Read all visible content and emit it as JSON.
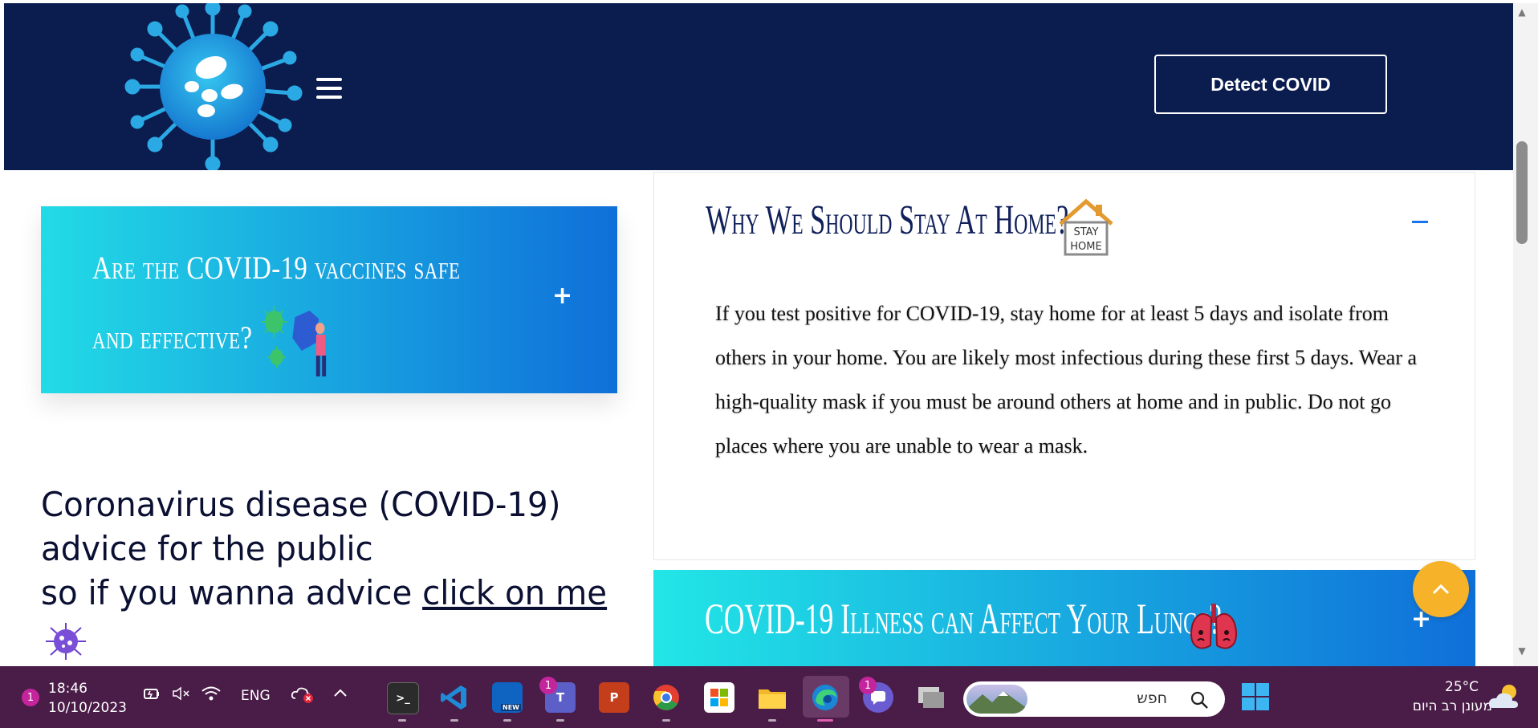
{
  "header": {
    "detect_button": "Detect COVID"
  },
  "faq": {
    "vaccines_title": "Are the COVID-19 vaccines safe and effective?",
    "vaccines_toggle": "+",
    "stay_home_title": "Why We Should Stay At Home?",
    "stay_home_icon_text_1": "STAY",
    "stay_home_icon_text_2": "HOME",
    "stay_home_toggle": "−",
    "stay_home_body": "If you test positive for COVID-19, stay home for at least 5 days and isolate from others in your home. You are likely most infectious during these first 5 days. Wear a high-quality mask if you must be around others at home and in public. Do not go places where you are unable to wear a mask.",
    "lungs_title": "COVID-19 Illness can Affect Your Lungs?",
    "lungs_toggle": "+"
  },
  "advice": {
    "line1": "Coronavirus disease (COVID-19)",
    "line2": "advice for the public",
    "line3_prefix": "so if you wanna advice ",
    "link": "click on me"
  },
  "taskbar": {
    "notification_count": "1",
    "time": "18:46",
    "date": "10/10/2023",
    "language": "ENG",
    "teams_badge": "1",
    "chat_badge": "1",
    "outlook_label": "NEW",
    "search_placeholder": "חפש",
    "weather_temp": "25°C",
    "weather_desc": "מעונן רב היום"
  },
  "colors": {
    "header_bg": "#0b1c4f",
    "accent_gradient_start": "#22dbe6",
    "accent_gradient_end": "#0f6fd9",
    "scroll_top": "#f6b32a",
    "taskbar_bg": "#4a1c48"
  }
}
